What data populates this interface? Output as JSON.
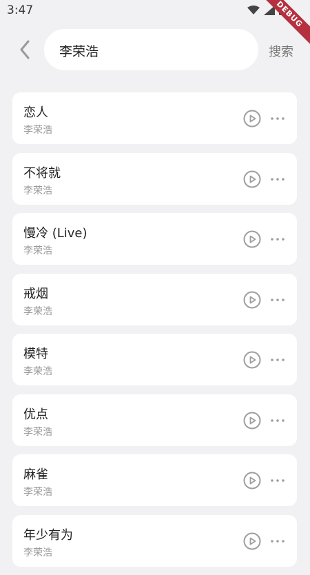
{
  "status_bar": {
    "time": "3:47"
  },
  "debug_banner": "DEBUG",
  "search": {
    "query": "李荣浩",
    "button_label": "搜索"
  },
  "songs": [
    {
      "title": "恋人",
      "artist": "李荣浩"
    },
    {
      "title": "不将就",
      "artist": "李荣浩"
    },
    {
      "title": "慢冷 (Live)",
      "artist": "李荣浩"
    },
    {
      "title": "戒烟",
      "artist": "李荣浩"
    },
    {
      "title": "模特",
      "artist": "李荣浩"
    },
    {
      "title": "优点",
      "artist": "李荣浩"
    },
    {
      "title": "麻雀",
      "artist": "李荣浩"
    },
    {
      "title": "年少有为",
      "artist": "李荣浩"
    }
  ],
  "icons": {
    "back": "chevron-left-icon",
    "play": "play-circle-icon",
    "more": "more-dots-icon",
    "wifi": "wifi-icon",
    "signal": "signal-icon",
    "battery": "battery-icon"
  },
  "colors": {
    "background": "#f1f1f3",
    "card": "#ffffff",
    "icon": "#9e9e9e",
    "debug": "#b5313f"
  }
}
